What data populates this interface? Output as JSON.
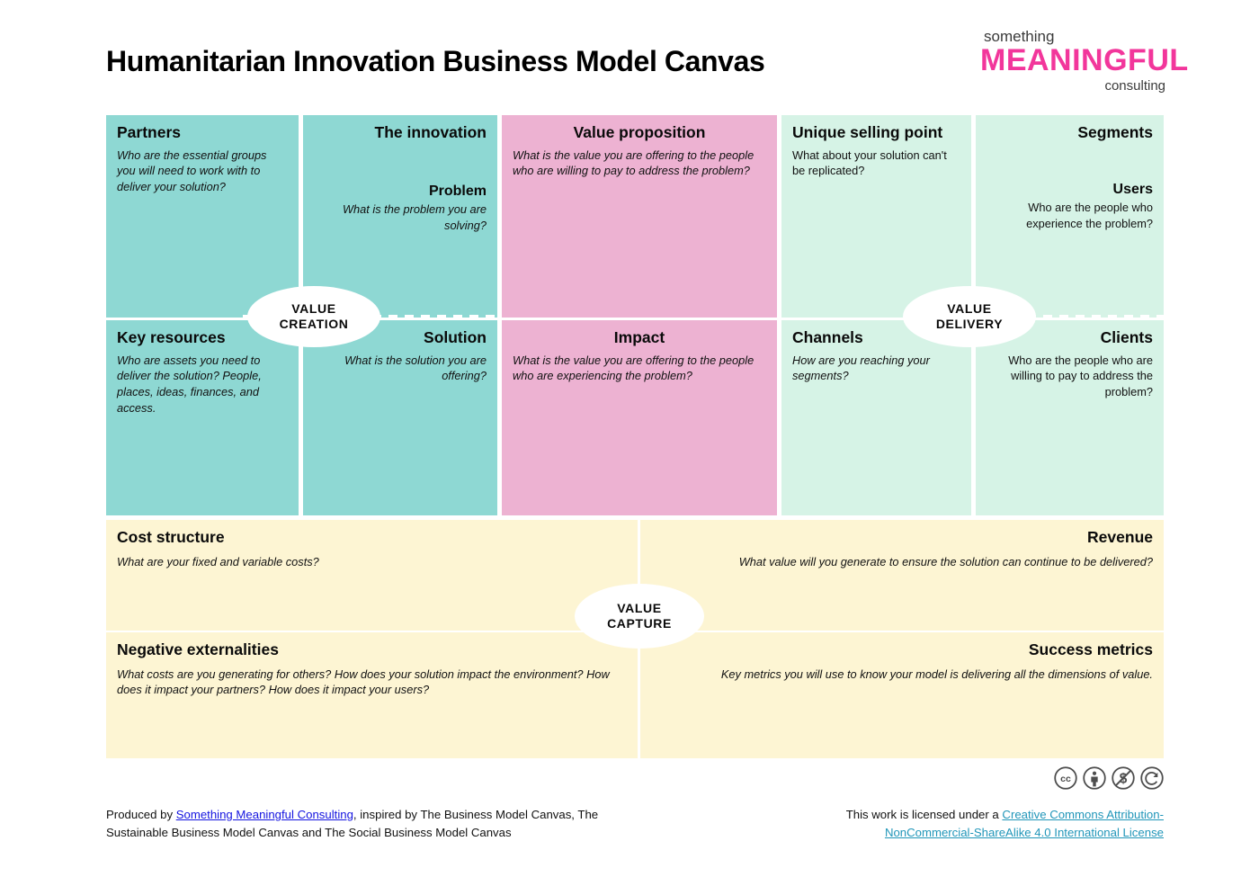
{
  "header": {
    "title": "Humanitarian Innovation Business Model Canvas",
    "logo": {
      "line1": "something",
      "line2": "MEANINGFUL",
      "line3": "consulting"
    }
  },
  "colors": {
    "teal": "#8ed8d3",
    "pink": "#edb2d2",
    "mint": "#d6f3e6",
    "cream": "#fdf5d3",
    "logo_pink": "#F2369B",
    "link_blue": "#1414e0",
    "link_teal": "#2196b9"
  },
  "canvas": {
    "partners": {
      "title": "Partners",
      "body": "Who are the essential groups you will need to work with to deliver your solution?"
    },
    "innovation": {
      "title": "The innovation",
      "sub_title": "Problem",
      "body": "What is the problem you are solving?"
    },
    "value_proposition": {
      "title": "Value proposition",
      "body": "What is the value you are offering to the people who are willing to pay to address the problem?"
    },
    "unique_selling_point": {
      "title": "Unique selling point",
      "body": "What about your solution can't be replicated?"
    },
    "segments": {
      "title": "Segments",
      "sub_title": "Users",
      "body": "Who are the people who experience the problem?"
    },
    "key_resources": {
      "title": "Key resources",
      "body": "Who are assets you need to deliver the solution? People, places, ideas, finances, and access."
    },
    "solution": {
      "title": "Solution",
      "body": "What is the solution you are offering?"
    },
    "impact": {
      "title": "Impact",
      "body": "What is the value you are offering to the people who are experiencing the problem?"
    },
    "channels": {
      "title": "Channels",
      "body": "How are you reaching your segments?"
    },
    "clients": {
      "title": "Clients",
      "body": "Who are the people who are willing to pay to address the problem?"
    },
    "cost_structure": {
      "title": "Cost structure",
      "body": "What are your fixed and variable costs?"
    },
    "revenue": {
      "title": "Revenue",
      "body": "What value will you generate to ensure the solution can continue to be delivered?"
    },
    "negative_externalities": {
      "title": "Negative externalities",
      "body": "What costs are you generating for others? How does your solution impact the environment? How does it impact your partners? How does it impact your users?"
    },
    "success_metrics": {
      "title": "Success metrics",
      "body": "Key metrics you will use to know  your model is delivering all the dimensions of value."
    }
  },
  "ellipses": {
    "value_creation": "VALUE\nCREATION",
    "value_creation_line1": "VALUE",
    "value_creation_line2": "CREATION",
    "value_delivery_line1": "VALUE",
    "value_delivery_line2": "DELIVERY",
    "value_capture_line1": "VALUE",
    "value_capture_line2": "CAPTURE"
  },
  "footer": {
    "left_prefix": "Produced by ",
    "left_link": "Something Meaningful Consulting",
    "left_suffix": ", inspired by The Business Model Canvas, The Sustainable Business Model Canvas and The Social Business Model Canvas",
    "right_prefix": "This work is licensed under a ",
    "right_link": "Creative Commons Attribution-NonCommercial-ShareAlike 4.0 International License",
    "cc_icons": [
      "cc-icon",
      "cc-by-icon",
      "cc-nc-icon",
      "cc-sa-icon"
    ]
  }
}
